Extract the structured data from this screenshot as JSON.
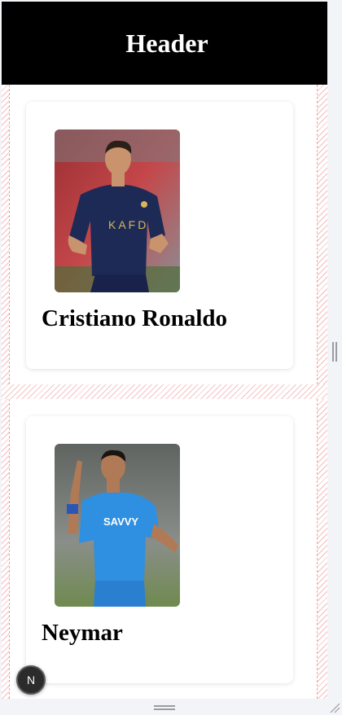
{
  "header": {
    "title": "Header"
  },
  "players": [
    {
      "name": "Cristiano Ronaldo",
      "photo_icon": "player-photo-ronaldo",
      "jersey_color": "#1d2a56",
      "background_color": "#b63a3d"
    },
    {
      "name": "Neymar",
      "photo_icon": "player-photo-neymar",
      "jersey_color": "#2f8fe0",
      "background_color": "#7b7f7c"
    }
  ],
  "devtools": {
    "badge_letter": "N"
  },
  "colors": {
    "header_bg": "#000000",
    "header_text": "#ffffff",
    "guide_stripes": "#ec7878"
  }
}
